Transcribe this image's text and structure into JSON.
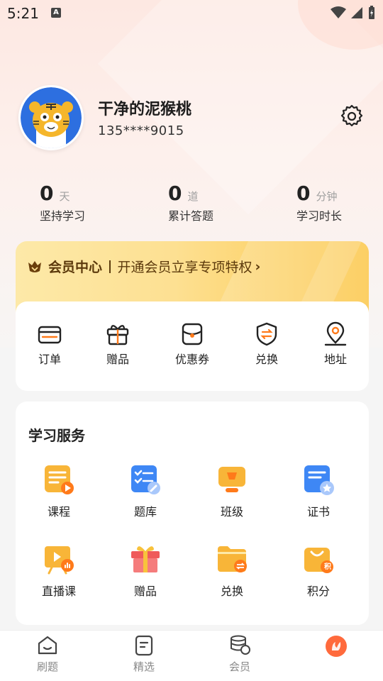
{
  "status_bar": {
    "time": "5:21",
    "a_icon": "A"
  },
  "profile": {
    "name": "干净的泥猴桃",
    "phone": "135****9015"
  },
  "stats": [
    {
      "value": "0",
      "unit": "天",
      "label": "坚持学习"
    },
    {
      "value": "0",
      "unit": "道",
      "label": "累计答题"
    },
    {
      "value": "0",
      "unit": "分钟",
      "label": "学习时长"
    }
  ],
  "vip": {
    "title": "会员中心",
    "desc": "开通会员立享专项特权",
    "arrow": "›"
  },
  "shop": [
    {
      "label": "订单",
      "icon": "order-icon"
    },
    {
      "label": "赠品",
      "icon": "gift-icon"
    },
    {
      "label": "优惠券",
      "icon": "coupon-icon"
    },
    {
      "label": "兑换",
      "icon": "exchange-shield-icon"
    },
    {
      "label": "地址",
      "icon": "location-icon"
    }
  ],
  "study": {
    "title": "学习服务",
    "items": [
      {
        "label": "课程",
        "icon": "course-icon"
      },
      {
        "label": "题库",
        "icon": "question-bank-icon"
      },
      {
        "label": "班级",
        "icon": "class-icon"
      },
      {
        "label": "证书",
        "icon": "certificate-icon"
      },
      {
        "label": "直播课",
        "icon": "live-course-icon"
      },
      {
        "label": "赠品",
        "icon": "gift-box-icon"
      },
      {
        "label": "兑换",
        "icon": "redeem-folder-icon"
      },
      {
        "label": "积分",
        "icon": "points-bag-icon"
      }
    ],
    "points_badge": "积"
  },
  "bottom_nav": [
    {
      "label": "刷题",
      "icon": "home-icon"
    },
    {
      "label": "精选",
      "icon": "featured-icon"
    },
    {
      "label": "会员",
      "icon": "coins-icon"
    },
    {
      "label": "",
      "icon": "profile-icon"
    }
  ],
  "colors": {
    "accent": "#ff7a1a",
    "vip_text": "#5c3a0c",
    "vip_gold": "#fcc74a"
  }
}
